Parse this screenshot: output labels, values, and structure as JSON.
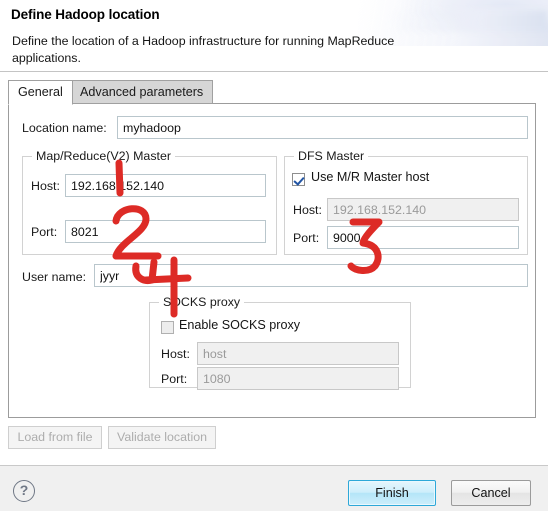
{
  "wizard": {
    "title": "Define Hadoop location",
    "description": "Define the location of a Hadoop infrastructure for running MapReduce applications."
  },
  "tabs": [
    {
      "label": "General",
      "active": true
    },
    {
      "label": "Advanced parameters",
      "active": false
    }
  ],
  "general": {
    "location_name": {
      "label": "Location name:",
      "value": "myhadoop",
      "placeholder": ""
    },
    "mapreduce_master": {
      "group_title": "Map/Reduce(V2) Master",
      "host": {
        "label": "Host:",
        "value": "192.168.152.140",
        "enabled": true
      },
      "port": {
        "label": "Port:",
        "value": "8021",
        "enabled": true
      }
    },
    "dfs_master": {
      "group_title": "DFS Master",
      "use_mr_master_host": {
        "label": "Use M/R Master host",
        "checked": true
      },
      "host": {
        "label": "Host:",
        "value": "192.168.152.140",
        "enabled": false
      },
      "port": {
        "label": "Port:",
        "value": "9000",
        "enabled": true
      }
    },
    "user_name": {
      "label": "User name:",
      "value": "jyyr"
    },
    "socks_proxy": {
      "group_title": "SOCKS proxy",
      "enable": {
        "label": "Enable SOCKS proxy",
        "checked": false
      },
      "host": {
        "label": "Host:",
        "value": "host",
        "enabled": false
      },
      "port": {
        "label": "Port:",
        "value": "1080",
        "enabled": false
      }
    }
  },
  "actions": {
    "load_from_file": {
      "label": "Load from file",
      "enabled": false
    },
    "validate_location": {
      "label": "Validate location",
      "enabled": false
    }
  },
  "footer": {
    "help": "?",
    "finish": "Finish",
    "cancel": "Cancel"
  },
  "annotations": {
    "color": "#dd2b26",
    "marks": [
      {
        "text": "1",
        "near": "mapreduce-host-field"
      },
      {
        "text": "2",
        "near": "mapreduce-port-field"
      },
      {
        "text": "3",
        "near": "dfs-port-field"
      },
      {
        "text": "4",
        "near": "user-name-field"
      }
    ]
  }
}
